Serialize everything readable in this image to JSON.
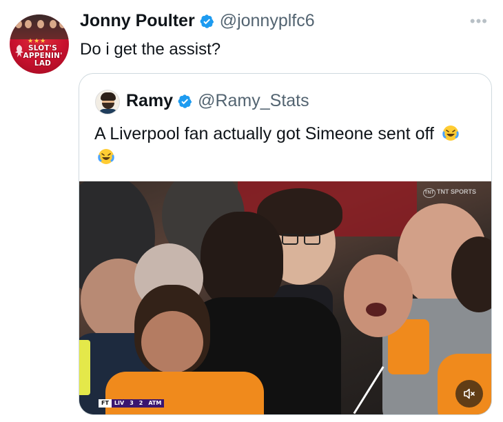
{
  "tweet": {
    "author_name": "Jonny Poulter",
    "author_handle": "@jonnyplfc6",
    "text": "Do i get the assist?",
    "avatar_text": "SLOT'S APPENIN' LAD",
    "more_label": "•••"
  },
  "quote": {
    "author_name": "Ramy",
    "author_handle": "@Ramy_Stats",
    "text": "A Liverpool fan actually got Simeone sent off",
    "emoji": [
      "face-with-tears-of-joy",
      "face-with-tears-of-joy"
    ]
  },
  "video": {
    "broadcaster": "TNT SPORTS",
    "scoreboard": {
      "status": "FT",
      "home": "LIV",
      "home_score": "3",
      "away_score": "2",
      "away": "ATM"
    }
  },
  "colors": {
    "verified": "#1d9bf0",
    "handle": "#536471",
    "border": "#cfd9de",
    "avatar_red": "#c8102e"
  },
  "icons": [
    "verified-badge-icon",
    "more-icon",
    "mute-icon",
    "emoji-laughing-icon"
  ]
}
